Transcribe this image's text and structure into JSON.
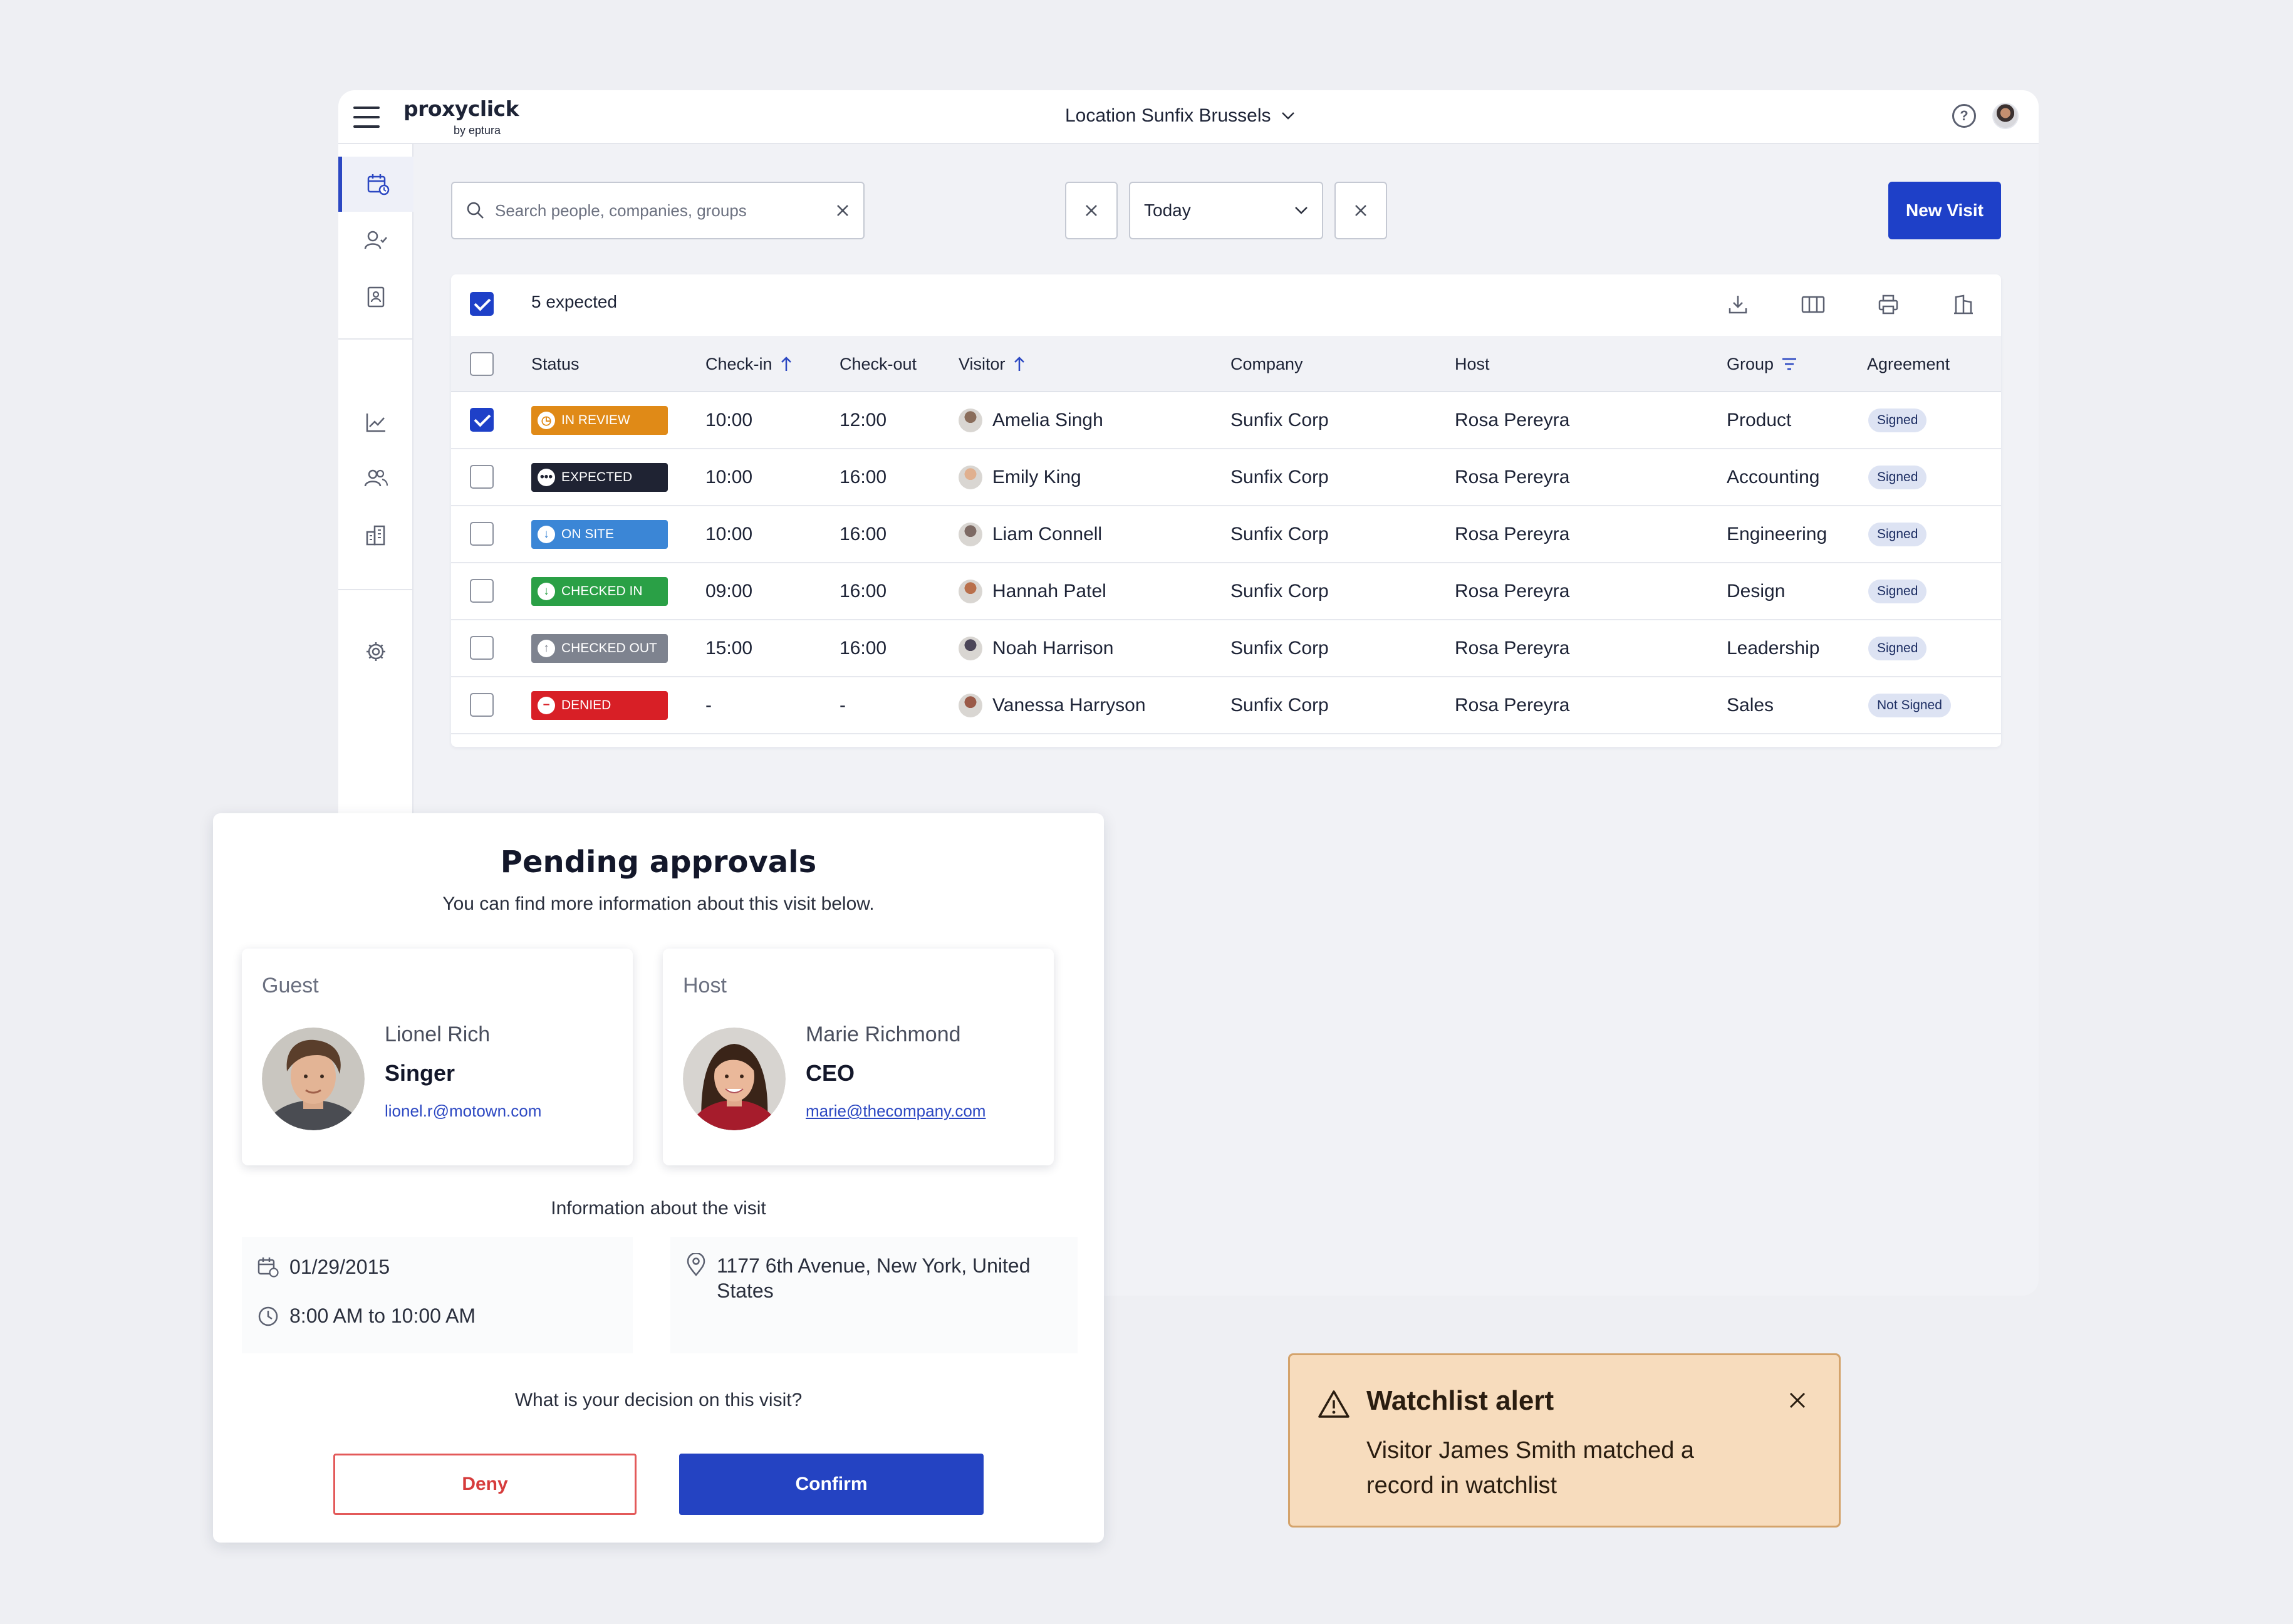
{
  "header": {
    "logo_main": "proxyclick",
    "logo_sub": "by eptura",
    "location": "Location Sunfix Brussels"
  },
  "sidebar": {
    "items": [
      "calendar-visits-icon",
      "visitor-check-icon",
      "badge-contact-icon",
      "chart-icon",
      "users-icon",
      "buildings-icon",
      "settings-gear-icon"
    ]
  },
  "toolbar": {
    "search_placeholder": "Search people, companies, groups",
    "date_value": "Today",
    "new_visit_label": "New Visit"
  },
  "table": {
    "expected_label": "5 expected",
    "columns": [
      "Status",
      "Check-in",
      "Check-out",
      "Visitor",
      "Company",
      "Host",
      "Group",
      "Agreement"
    ],
    "rows": [
      {
        "status": "In Review",
        "status_color": "#e08a17",
        "status_icon": "clock",
        "checkin": "10:00",
        "checkout": "12:00",
        "visitor": "Amelia Singh",
        "company": "Sunfix Corp",
        "host": "Rosa Pereyra",
        "group": "Product",
        "agreement": "Signed",
        "checked": true
      },
      {
        "status": "Expected",
        "status_color": "#1f2333",
        "status_icon": "dots",
        "checkin": "10:00",
        "checkout": "16:00",
        "visitor": "Emily King",
        "company": "Sunfix Corp",
        "host": "Rosa Pereyra",
        "group": "Accounting",
        "agreement": "Signed",
        "checked": false
      },
      {
        "status": "On Site",
        "status_color": "#3b86d6",
        "status_icon": "arrow-down",
        "checkin": "10:00",
        "checkout": "16:00",
        "visitor": "Liam Connell",
        "company": "Sunfix Corp",
        "host": "Rosa Pereyra",
        "group": "Engineering",
        "agreement": "Signed",
        "checked": false
      },
      {
        "status": "Checked In",
        "status_color": "#2aa046",
        "status_icon": "arrow-down",
        "checkin": "09:00",
        "checkout": "16:00",
        "visitor": "Hannah Patel",
        "company": "Sunfix Corp",
        "host": "Rosa Pereyra",
        "group": "Design",
        "agreement": "Signed",
        "checked": false
      },
      {
        "status": "Checked Out",
        "status_color": "#7e838f",
        "status_icon": "arrow-up",
        "checkin": "15:00",
        "checkout": "16:00",
        "visitor": "Noah Harrison",
        "company": "Sunfix Corp",
        "host": "Rosa Pereyra",
        "group": "Leadership",
        "agreement": "Signed",
        "checked": false
      },
      {
        "status": "Denied",
        "status_color": "#d81f26",
        "status_icon": "minus",
        "checkin": "-",
        "checkout": "-",
        "visitor": "Vanessa Harryson",
        "company": "Sunfix Corp",
        "host": "Rosa Pereyra",
        "group": "Sales",
        "agreement": "Not Signed",
        "checked": false
      }
    ]
  },
  "approval": {
    "title": "Pending approvals",
    "subtitle": "You can find more information about this visit below.",
    "guest": {
      "role": "Guest",
      "name": "Lionel Rich",
      "title": "Singer",
      "email": "lionel.r@motown.com"
    },
    "host": {
      "role": "Host",
      "name": "Marie Richmond",
      "title": "CEO",
      "email": "marie@thecompany.com"
    },
    "info_heading": "Information about the visit",
    "date": "01/29/2015",
    "time": "8:00 AM to 10:00 AM",
    "address": "1177 6th Avenue, New York, United States",
    "decision_question": "What is your decision on this visit?",
    "deny_label": "Deny",
    "confirm_label": "Confirm"
  },
  "alert": {
    "title": "Watchlist alert",
    "message": "Visitor James Smith matched a record in watchlist"
  }
}
